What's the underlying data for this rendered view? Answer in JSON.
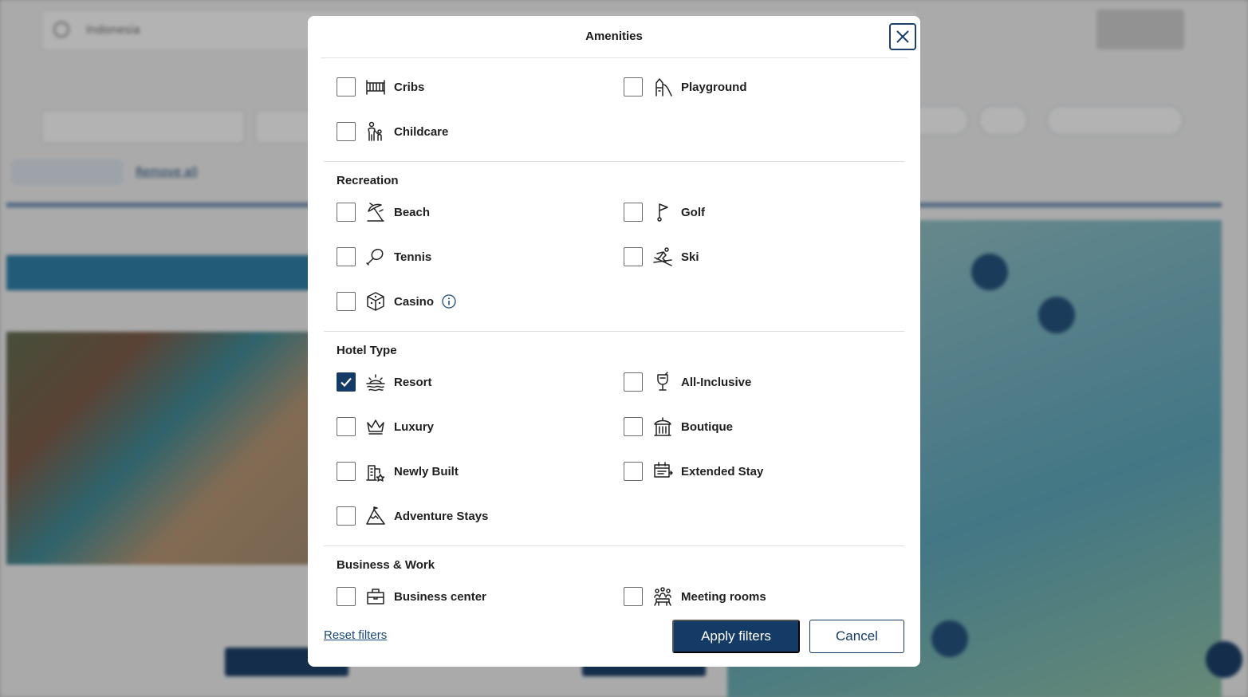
{
  "background": {
    "search_value": "Indonesia",
    "remove_all": "Remove all"
  },
  "modal": {
    "title": "Amenities",
    "sections": {
      "family": {
        "items": {
          "cribs": {
            "label": "Cribs",
            "checked": false,
            "icon": "crib-icon"
          },
          "playground": {
            "label": "Playground",
            "checked": false,
            "icon": "playground-icon"
          },
          "childcare": {
            "label": "Childcare",
            "checked": false,
            "icon": "childcare-icon"
          }
        }
      },
      "recreation": {
        "title": "Recreation",
        "items": {
          "beach": {
            "label": "Beach",
            "checked": false,
            "icon": "beach-umbrella-icon"
          },
          "golf": {
            "label": "Golf",
            "checked": false,
            "icon": "golf-flag-icon"
          },
          "tennis": {
            "label": "Tennis",
            "checked": false,
            "icon": "tennis-racket-icon"
          },
          "ski": {
            "label": "Ski",
            "checked": false,
            "icon": "skier-icon"
          },
          "casino": {
            "label": "Casino",
            "checked": false,
            "icon": "dice-icon",
            "has_info": true
          }
        }
      },
      "hotel_type": {
        "title": "Hotel Type",
        "items": {
          "resort": {
            "label": "Resort",
            "checked": true,
            "icon": "sunset-icon"
          },
          "all_inclusive": {
            "label": "All-Inclusive",
            "checked": false,
            "icon": "cocktail-icon"
          },
          "luxury": {
            "label": "Luxury",
            "checked": false,
            "icon": "crown-icon"
          },
          "boutique": {
            "label": "Boutique",
            "checked": false,
            "icon": "boutique-building-icon"
          },
          "newly_built": {
            "label": "Newly Built",
            "checked": false,
            "icon": "new-building-icon"
          },
          "extended_stay": {
            "label": "Extended Stay",
            "checked": false,
            "icon": "calendar-icon"
          },
          "adventure_stays": {
            "label": "Adventure Stays",
            "checked": false,
            "icon": "mountain-icon"
          }
        }
      },
      "business": {
        "title": "Business & Work",
        "items": {
          "business_center": {
            "label": "Business center",
            "checked": false,
            "icon": "briefcase-icon"
          },
          "meeting_rooms": {
            "label": "Meeting rooms",
            "checked": false,
            "icon": "meeting-people-icon"
          }
        }
      }
    },
    "footer": {
      "reset_label": "Reset filters",
      "apply_label": "Apply filters",
      "cancel_label": "Cancel"
    }
  },
  "colors": {
    "primary": "#143a66",
    "link": "#1b4a7a"
  }
}
